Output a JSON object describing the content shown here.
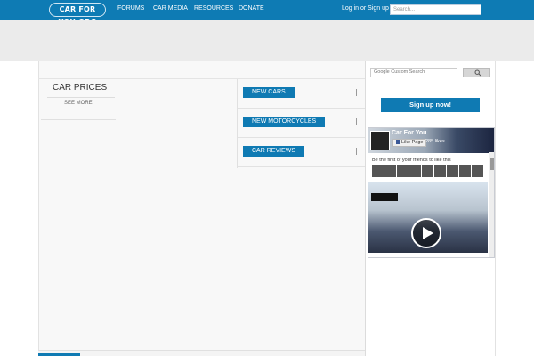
{
  "header": {
    "logo_text": "CAR FOR YOU.ORG",
    "nav": [
      "FORUMS",
      "CAR MEDIA",
      "RESOURCES",
      "DONATE"
    ],
    "login": "Log in or Sign up",
    "search_placeholder": "Search..."
  },
  "car_prices": {
    "title": "CAR PRICES",
    "see_more": "SEE MORE"
  },
  "categories": [
    "NEW CARS",
    "NEW MOTORCYCLES",
    "CAR REVIEWS"
  ],
  "sidebar": {
    "search_placeholder": "Google Custom Search",
    "signup_label": "Sign up now!",
    "facebook": {
      "page_name": "Car For You",
      "like_label": "Like Page",
      "likes_count": "285 likes",
      "friends_text": "Be the first of your friends to like this"
    }
  },
  "colors": {
    "brand_blue": "#0e7bb4",
    "button_blue": "#0f7ab3"
  }
}
